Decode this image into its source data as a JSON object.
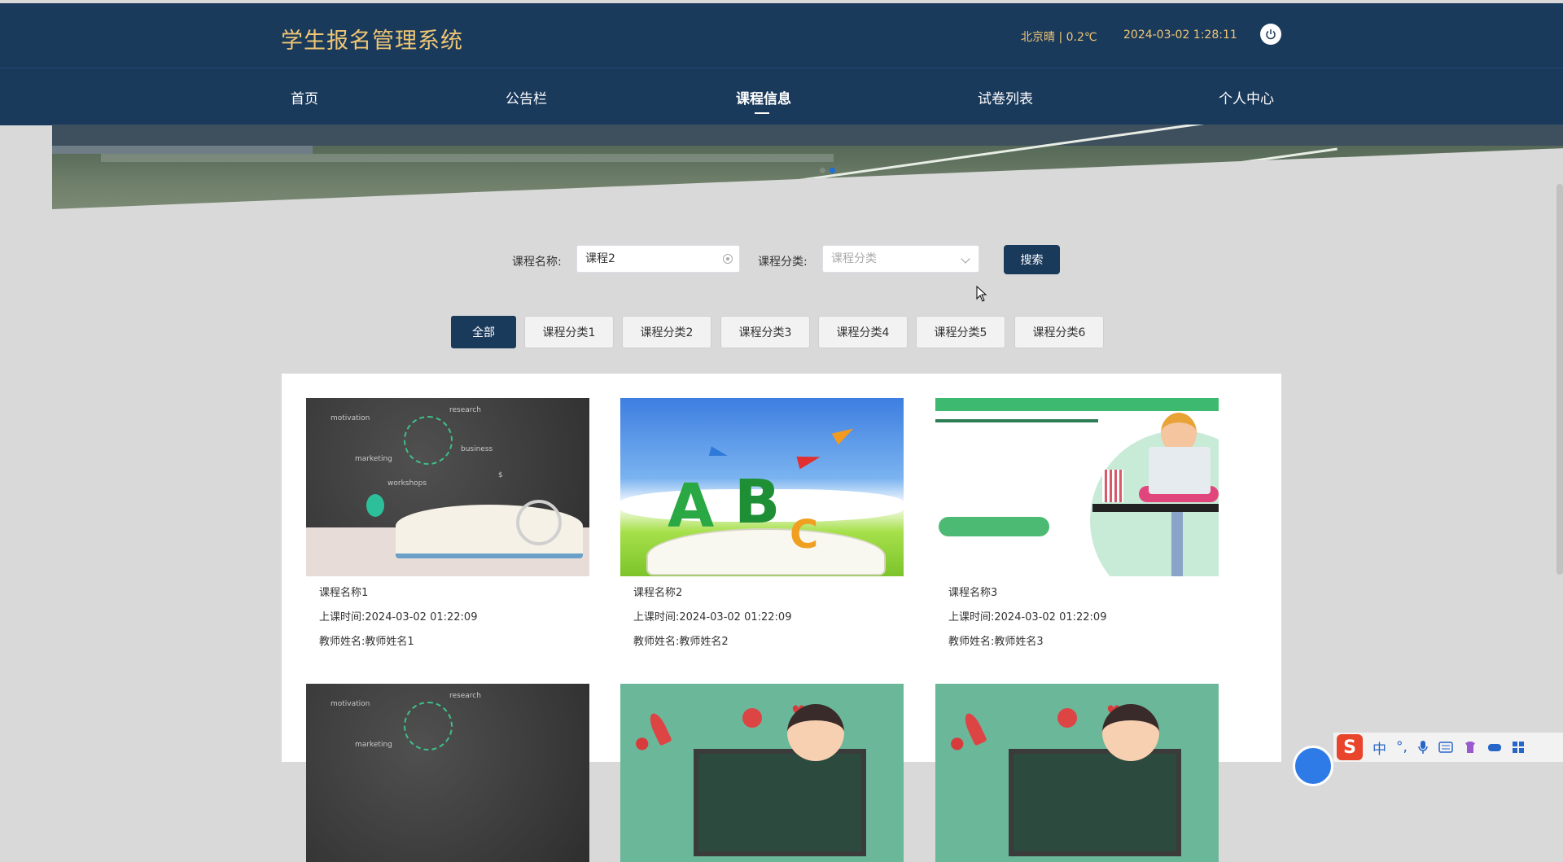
{
  "header": {
    "app_title": "学生报名管理系统",
    "weather": "北京晴 | 0.2℃",
    "datetime": "2024-03-02  1:28:11"
  },
  "nav": {
    "items": [
      {
        "label": "首页"
      },
      {
        "label": "公告栏"
      },
      {
        "label": "课程信息"
      },
      {
        "label": "试卷列表"
      },
      {
        "label": "个人中心"
      }
    ],
    "active_index": 2
  },
  "search": {
    "course_name_label": "课程名称:",
    "course_name_value": "课程2",
    "category_label": "课程分类:",
    "category_placeholder": "课程分类",
    "search_button": "搜索"
  },
  "categories": [
    "全部",
    "课程分类1",
    "课程分类2",
    "课程分类3",
    "课程分类4",
    "课程分类5",
    "课程分类6"
  ],
  "active_category_index": 0,
  "courses": [
    {
      "name": "课程名称1",
      "time_label": "上课时间:",
      "time": "2024-03-02 01:22:09",
      "teacher_label": "教师姓名:",
      "teacher": "教师姓名1",
      "image": "chalkboard-book"
    },
    {
      "name": "课程名称2",
      "time_label": "上课时间:",
      "time": "2024-03-02 01:22:09",
      "teacher_label": "教师姓名:",
      "teacher": "教师姓名2",
      "image": "abc-book"
    },
    {
      "name": "课程名称3",
      "time_label": "上课时间:",
      "time": "2024-03-02 01:22:09",
      "teacher_label": "教师姓名:",
      "teacher": "教师姓名3",
      "image": "teacher-laptop"
    },
    {
      "image": "chalkboard-book"
    },
    {
      "image": "kids-classroom"
    },
    {
      "image": "kids-classroom"
    }
  ],
  "ime_toolbar": {
    "logo": "S",
    "mode": "中",
    "punct": "°,"
  },
  "colors": {
    "primary": "#1a3a5c",
    "title_gold": "#f0c674",
    "background": "#d9d9d9"
  },
  "icons": [
    "power-icon",
    "clear-icon",
    "chevron-down-icon",
    "mouse-cursor-icon",
    "mic-icon",
    "keyboard-icon"
  ]
}
